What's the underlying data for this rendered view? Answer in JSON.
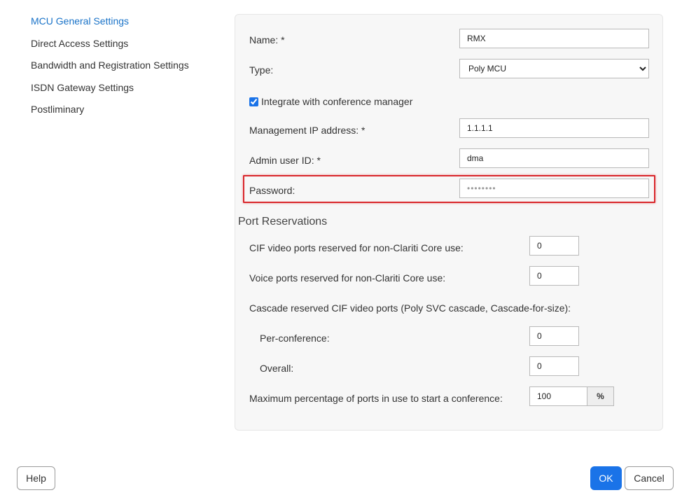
{
  "nav": {
    "items": [
      {
        "label": "MCU General Settings",
        "active": true
      },
      {
        "label": "Direct Access Settings",
        "active": false
      },
      {
        "label": "Bandwidth and Registration Settings",
        "active": false
      },
      {
        "label": "ISDN Gateway Settings",
        "active": false
      },
      {
        "label": "Postliminary",
        "active": false
      }
    ]
  },
  "form": {
    "name_label": "Name: *",
    "name_value": "RMX",
    "type_label": "Type:",
    "type_value": "Poly MCU",
    "integrate_label": "Integrate with conference manager",
    "integrate_checked": true,
    "mgmt_ip_label": "Management IP address: *",
    "mgmt_ip_value": "1.1.1.1",
    "admin_label": "Admin user ID: *",
    "admin_value": "dma",
    "password_label": "Password:",
    "password_value": "••••••••"
  },
  "ports": {
    "section_title": "Port Reservations",
    "cif_label": "CIF video ports reserved for non-Clariti Core use:",
    "cif_value": "0",
    "voice_label": "Voice ports reserved for non-Clariti Core use:",
    "voice_value": "0",
    "cascade_label": "Cascade reserved CIF video ports (Poly SVC cascade, Cascade-for-size):",
    "per_conf_label": "Per-conference:",
    "per_conf_value": "0",
    "overall_label": "Overall:",
    "overall_value": "0",
    "max_pct_label": "Maximum percentage of ports in use to start a conference:",
    "max_pct_value": "100",
    "pct_symbol": "%"
  },
  "footer": {
    "help_label": "Help",
    "ok_label": "OK",
    "cancel_label": "Cancel"
  },
  "colors": {
    "accent": "#1a73e8",
    "nav_active": "#1a73c8",
    "highlight": "#d9262b",
    "panel_bg": "#f7f7f7"
  }
}
